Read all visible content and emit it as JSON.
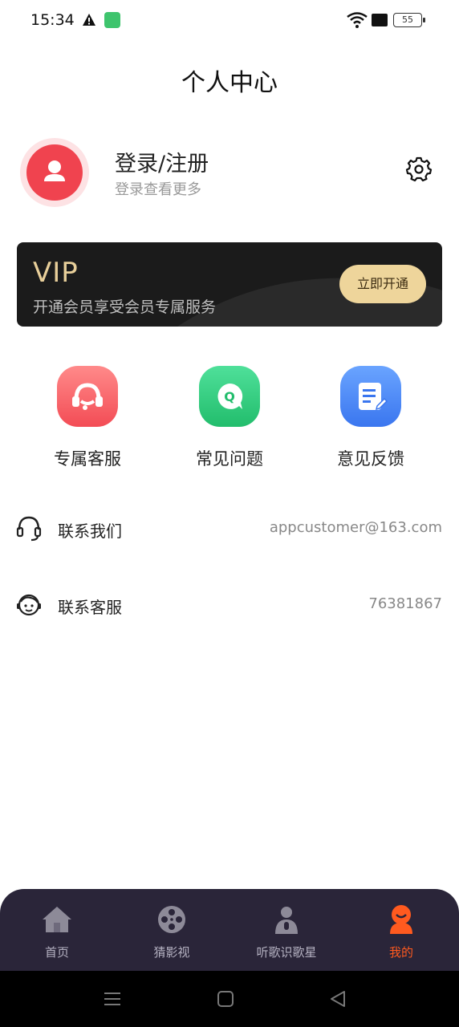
{
  "status_bar": {
    "time": "15:34",
    "battery": "55"
  },
  "header": {
    "title": "个人中心"
  },
  "profile": {
    "title": "登录/注册",
    "subtitle": "登录查看更多"
  },
  "vip": {
    "title": "VIP",
    "description": "开通会员享受会员专属服务",
    "button": "立即开通"
  },
  "quick_actions": [
    {
      "label": "专属客服",
      "icon": "headset-icon",
      "color": "#f34c55"
    },
    {
      "label": "常见问题",
      "icon": "faq-q-icon",
      "color": "#22bd6c"
    },
    {
      "label": "意见反馈",
      "icon": "feedback-note-icon",
      "color": "#3a76ef"
    }
  ],
  "contacts": [
    {
      "label": "联系我们",
      "value": "appcustomer@163.com",
      "icon": "headphones-icon"
    },
    {
      "label": "联系客服",
      "value": "76381867",
      "icon": "agent-face-icon"
    }
  ],
  "tabs": [
    {
      "label": "首页",
      "icon": "home-icon"
    },
    {
      "label": "猜影视",
      "icon": "film-reel-icon"
    },
    {
      "label": "听歌识歌星",
      "icon": "singer-icon"
    },
    {
      "label": "我的",
      "icon": "profile-icon",
      "active": true
    }
  ],
  "colors": {
    "accent": "#ff5a1f",
    "vip_gold": "#e8cf9a",
    "tabbar_bg": "#2a2539"
  }
}
